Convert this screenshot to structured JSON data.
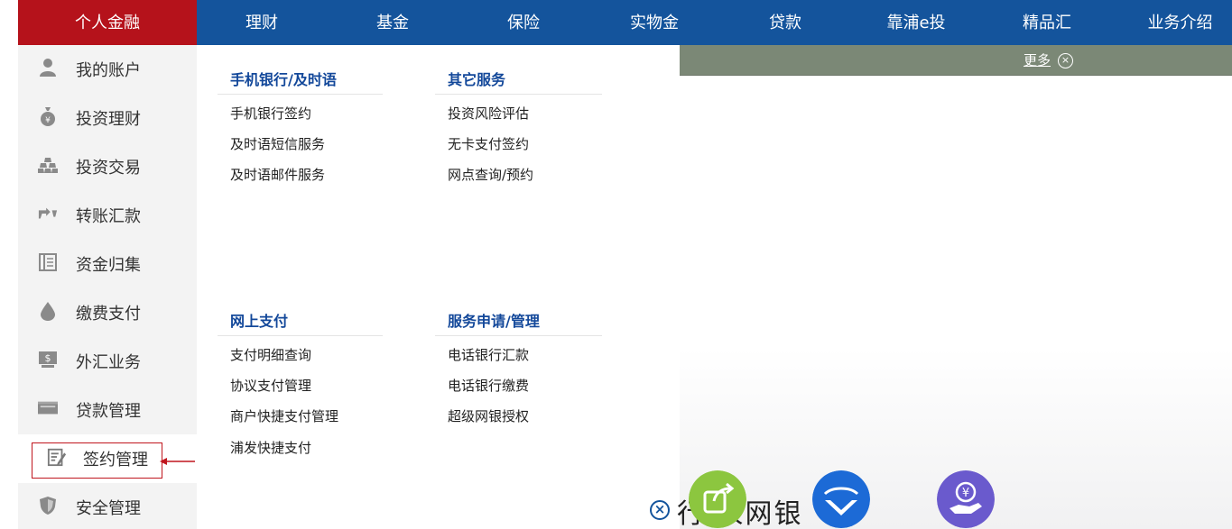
{
  "topnav": {
    "items": [
      {
        "label": "个人金融",
        "active": true
      },
      {
        "label": "理财"
      },
      {
        "label": "基金"
      },
      {
        "label": "保险"
      },
      {
        "label": "实物金"
      },
      {
        "label": "贷款"
      },
      {
        "label": "靠浦e投"
      },
      {
        "label": "精品汇"
      },
      {
        "label": "业务介绍"
      }
    ]
  },
  "subbar": {
    "more_label": "更多",
    "close_glyph": "×"
  },
  "sidebar": {
    "items": [
      {
        "label": "我的账户",
        "icon": "user-icon"
      },
      {
        "label": "投资理财",
        "icon": "money-bag-icon"
      },
      {
        "label": "投资交易",
        "icon": "gold-bars-icon"
      },
      {
        "label": "转账汇款",
        "icon": "transfer-icon"
      },
      {
        "label": "资金归集",
        "icon": "ledger-icon"
      },
      {
        "label": "缴费支付",
        "icon": "water-drop-icon"
      },
      {
        "label": "外汇业务",
        "icon": "dollar-screen-icon"
      },
      {
        "label": "贷款管理",
        "icon": "wallet-icon"
      },
      {
        "label": "签约管理",
        "icon": "sign-document-icon",
        "selected": true
      },
      {
        "label": "安全管理",
        "icon": "shield-icon"
      }
    ]
  },
  "menu": {
    "groups": [
      {
        "title": "手机银行/及时语",
        "links": [
          "手机银行签约",
          "及时语短信服务",
          "及时语邮件服务"
        ]
      },
      {
        "title": "其它服务",
        "links": [
          "投资风险评估",
          "无卡支付签约",
          "网点查询/预约"
        ]
      },
      {
        "title": "网上支付",
        "links": [
          "支付明细查询",
          "协议支付管理",
          "商户快捷支付管理",
          "浦发快捷支付"
        ]
      },
      {
        "title": "服务申请/管理",
        "links": [
          "电话银行汇款",
          "电话银行缴费",
          "超级网银授权"
        ]
      }
    ]
  },
  "bottom": {
    "title_partial": "行 人网银",
    "close_glyph": "×"
  },
  "colors": {
    "nav_blue": "#14549c",
    "active_red": "#b5121b",
    "subbar_green": "#7b8876",
    "group_title_blue": "#13489a",
    "highlight_red": "#c0151d"
  }
}
